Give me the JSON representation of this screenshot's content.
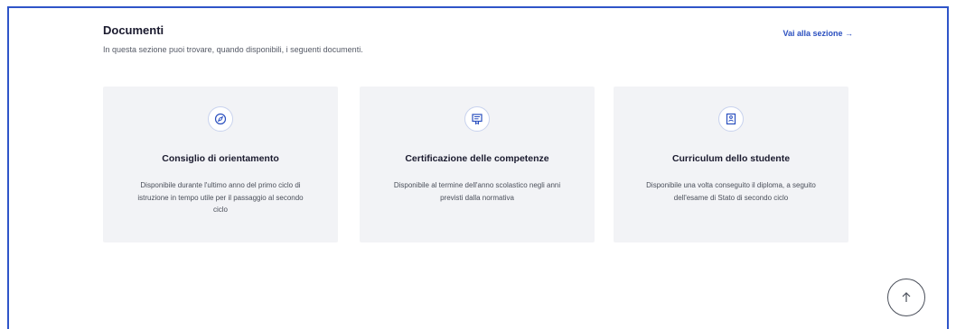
{
  "section": {
    "title": "Documenti",
    "subtitle": "In questa sezione puoi trovare, quando disponibili, i seguenti documenti.",
    "link_label": "Vai alla sezione →"
  },
  "cards": [
    {
      "icon": "compass-icon",
      "title": "Consiglio di orientamento",
      "description": "Disponibile durante l'ultimo anno del primo ciclo di istruzione in tempo utile per il passaggio al secondo ciclo"
    },
    {
      "icon": "certificate-icon",
      "title": "Certificazione delle competenze",
      "description": "Disponibile al termine dell'anno scolastico negli anni previsti dalla normativa"
    },
    {
      "icon": "document-icon",
      "title": "Curriculum dello studente",
      "description": "Disponibile una volta conseguito il diploma, a seguito dell'esame di Stato di secondo ciclo"
    }
  ],
  "colors": {
    "accent": "#2a4fbf",
    "frame_border": "#2f55c8",
    "card_background": "#f2f3f6"
  },
  "scroll_top": {
    "icon": "arrow-up-icon"
  }
}
